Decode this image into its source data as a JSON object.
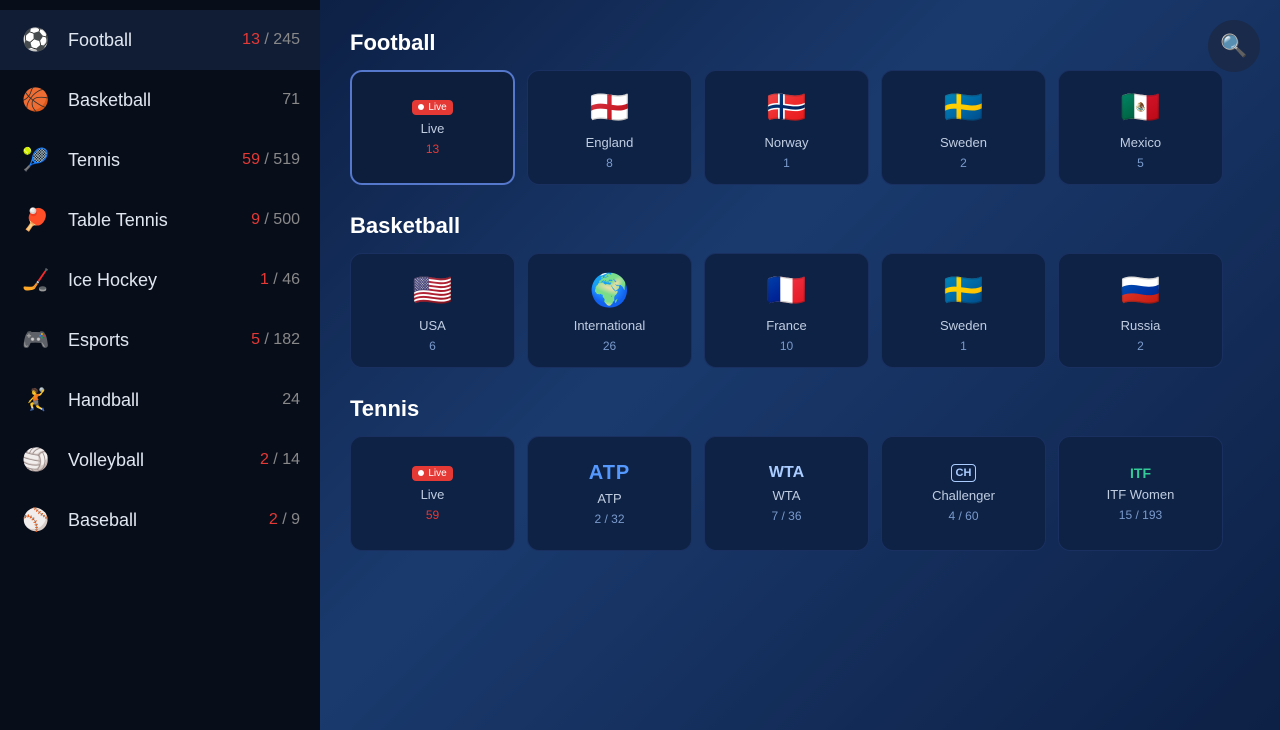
{
  "sidebar": {
    "items": [
      {
        "id": "football",
        "icon": "⚽",
        "name": "Football",
        "live": "13",
        "total": "245",
        "hasLive": true
      },
      {
        "id": "basketball",
        "icon": "🏀",
        "name": "Basketball",
        "count": "71",
        "hasLive": false
      },
      {
        "id": "tennis",
        "icon": "🎾",
        "name": "Tennis",
        "live": "59",
        "total": "519",
        "hasLive": true
      },
      {
        "id": "table-tennis",
        "icon": "🏓",
        "name": "Table Tennis",
        "live": "9",
        "total": "500",
        "hasLive": true
      },
      {
        "id": "ice-hockey",
        "icon": "🏒",
        "name": "Ice Hockey",
        "live": "1",
        "total": "46",
        "hasLive": true
      },
      {
        "id": "esports",
        "icon": "🎮",
        "name": "Esports",
        "live": "5",
        "total": "182",
        "hasLive": true
      },
      {
        "id": "handball",
        "icon": "🤾",
        "name": "Handball",
        "count": "24",
        "hasLive": false
      },
      {
        "id": "volleyball",
        "icon": "🏐",
        "name": "Volleyball",
        "live": "2",
        "total": "14",
        "hasLive": true
      },
      {
        "id": "baseball",
        "icon": "⚾",
        "name": "Baseball",
        "live": "2",
        "total": "9",
        "hasLive": true
      }
    ]
  },
  "search": {
    "label": "🔍"
  },
  "sections": [
    {
      "id": "football",
      "title": "Football",
      "cards": [
        {
          "id": "live",
          "type": "live",
          "label": "Live",
          "count": "13",
          "isLive": true
        },
        {
          "id": "england",
          "type": "flag",
          "flag": "🏴󠁧󠁢󠁥󠁮󠁧󠁿",
          "label": "England",
          "count": "8"
        },
        {
          "id": "norway",
          "type": "flag",
          "flag": "🇳🇴",
          "label": "Norway",
          "count": "1"
        },
        {
          "id": "sweden",
          "type": "flag",
          "flag": "🇸🇪",
          "label": "Sweden",
          "count": "2"
        },
        {
          "id": "mexico",
          "type": "flag",
          "flag": "🇲🇽",
          "label": "Mexico",
          "count": "5"
        }
      ]
    },
    {
      "id": "basketball",
      "title": "Basketball",
      "cards": [
        {
          "id": "usa",
          "type": "flag",
          "flag": "🇺🇸",
          "label": "USA",
          "count": "6"
        },
        {
          "id": "international",
          "type": "flag",
          "flag": "🌍",
          "label": "International",
          "count": "26"
        },
        {
          "id": "france",
          "type": "flag",
          "flag": "🇫🇷",
          "label": "France",
          "count": "10"
        },
        {
          "id": "sweden2",
          "type": "flag",
          "flag": "🇸🇪",
          "label": "Sweden",
          "count": "1"
        },
        {
          "id": "russia",
          "type": "flag",
          "flag": "🇷🇺",
          "label": "Russia",
          "count": "2"
        }
      ]
    },
    {
      "id": "tennis",
      "title": "Tennis",
      "cards": [
        {
          "id": "live-tennis",
          "type": "live",
          "label": "Live",
          "count": "59",
          "isLive": true
        },
        {
          "id": "atp",
          "type": "atp",
          "label": "ATP",
          "live": "2",
          "total": "32",
          "hasLive": true
        },
        {
          "id": "wta",
          "type": "wta",
          "label": "WTA",
          "live": "7",
          "total": "36",
          "hasLive": true
        },
        {
          "id": "challenger",
          "type": "challenger",
          "label": "Challenger",
          "live": "4",
          "total": "60",
          "hasLive": true
        },
        {
          "id": "itf-women",
          "type": "itf",
          "label": "ITF Women",
          "live": "15",
          "total": "193",
          "hasLive": true
        }
      ]
    }
  ]
}
